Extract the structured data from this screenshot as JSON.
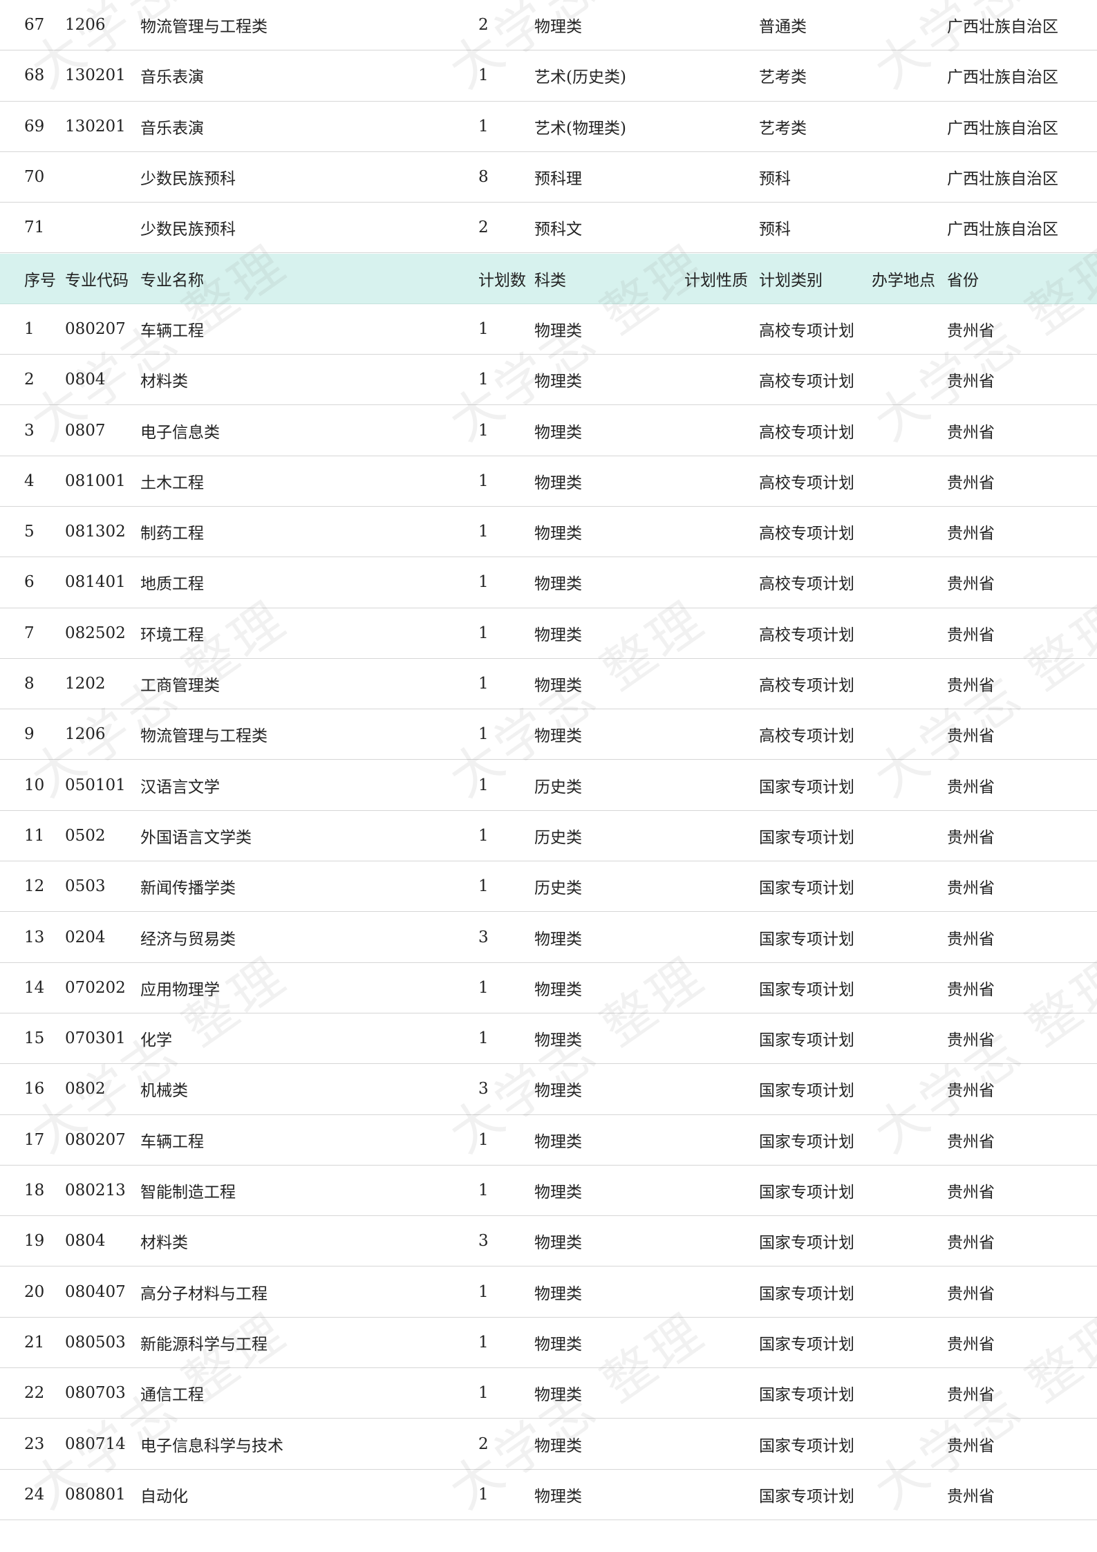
{
  "watermark": "大学志 整理",
  "prev_section_rows": [
    {
      "seq": "67",
      "code": "1206",
      "name": "物流管理与工程类",
      "num": "2",
      "subject": "物理类",
      "nature": "",
      "type": "普通类",
      "location": "",
      "province": "广西壮族自治区"
    },
    {
      "seq": "68",
      "code": "130201",
      "name": "音乐表演",
      "num": "1",
      "subject": "艺术(历史类)",
      "nature": "",
      "type": "艺考类",
      "location": "",
      "province": "广西壮族自治区"
    },
    {
      "seq": "69",
      "code": "130201",
      "name": "音乐表演",
      "num": "1",
      "subject": "艺术(物理类)",
      "nature": "",
      "type": "艺考类",
      "location": "",
      "province": "广西壮族自治区"
    },
    {
      "seq": "70",
      "code": "",
      "name": "少数民族预科",
      "num": "8",
      "subject": "预科理",
      "nature": "",
      "type": "预科",
      "location": "",
      "province": "广西壮族自治区"
    },
    {
      "seq": "71",
      "code": "",
      "name": "少数民族预科",
      "num": "2",
      "subject": "预科文",
      "nature": "",
      "type": "预科",
      "location": "",
      "province": "广西壮族自治区"
    }
  ],
  "header": {
    "seq": "序号",
    "code": "专业代码",
    "name": "专业名称",
    "num": "计划数",
    "subject": "科类",
    "nature": "计划性质",
    "type": "计划类别",
    "location": "办学地点",
    "province": "省份"
  },
  "rows": [
    {
      "seq": "1",
      "code": "080207",
      "name": "车辆工程",
      "num": "1",
      "subject": "物理类",
      "nature": "",
      "type": "高校专项计划",
      "location": "",
      "province": "贵州省"
    },
    {
      "seq": "2",
      "code": "0804",
      "name": "材料类",
      "num": "1",
      "subject": "物理类",
      "nature": "",
      "type": "高校专项计划",
      "location": "",
      "province": "贵州省"
    },
    {
      "seq": "3",
      "code": "0807",
      "name": "电子信息类",
      "num": "1",
      "subject": "物理类",
      "nature": "",
      "type": "高校专项计划",
      "location": "",
      "province": "贵州省"
    },
    {
      "seq": "4",
      "code": "081001",
      "name": "土木工程",
      "num": "1",
      "subject": "物理类",
      "nature": "",
      "type": "高校专项计划",
      "location": "",
      "province": "贵州省"
    },
    {
      "seq": "5",
      "code": "081302",
      "name": "制药工程",
      "num": "1",
      "subject": "物理类",
      "nature": "",
      "type": "高校专项计划",
      "location": "",
      "province": "贵州省"
    },
    {
      "seq": "6",
      "code": "081401",
      "name": "地质工程",
      "num": "1",
      "subject": "物理类",
      "nature": "",
      "type": "高校专项计划",
      "location": "",
      "province": "贵州省"
    },
    {
      "seq": "7",
      "code": "082502",
      "name": "环境工程",
      "num": "1",
      "subject": "物理类",
      "nature": "",
      "type": "高校专项计划",
      "location": "",
      "province": "贵州省"
    },
    {
      "seq": "8",
      "code": "1202",
      "name": "工商管理类",
      "num": "1",
      "subject": "物理类",
      "nature": "",
      "type": "高校专项计划",
      "location": "",
      "province": "贵州省"
    },
    {
      "seq": "9",
      "code": "1206",
      "name": "物流管理与工程类",
      "num": "1",
      "subject": "物理类",
      "nature": "",
      "type": "高校专项计划",
      "location": "",
      "province": "贵州省"
    },
    {
      "seq": "10",
      "code": "050101",
      "name": "汉语言文学",
      "num": "1",
      "subject": "历史类",
      "nature": "",
      "type": "国家专项计划",
      "location": "",
      "province": "贵州省"
    },
    {
      "seq": "11",
      "code": "0502",
      "name": "外国语言文学类",
      "num": "1",
      "subject": "历史类",
      "nature": "",
      "type": "国家专项计划",
      "location": "",
      "province": "贵州省"
    },
    {
      "seq": "12",
      "code": "0503",
      "name": "新闻传播学类",
      "num": "1",
      "subject": "历史类",
      "nature": "",
      "type": "国家专项计划",
      "location": "",
      "province": "贵州省"
    },
    {
      "seq": "13",
      "code": "0204",
      "name": "经济与贸易类",
      "num": "3",
      "subject": "物理类",
      "nature": "",
      "type": "国家专项计划",
      "location": "",
      "province": "贵州省"
    },
    {
      "seq": "14",
      "code": "070202",
      "name": "应用物理学",
      "num": "1",
      "subject": "物理类",
      "nature": "",
      "type": "国家专项计划",
      "location": "",
      "province": "贵州省"
    },
    {
      "seq": "15",
      "code": "070301",
      "name": "化学",
      "num": "1",
      "subject": "物理类",
      "nature": "",
      "type": "国家专项计划",
      "location": "",
      "province": "贵州省"
    },
    {
      "seq": "16",
      "code": "0802",
      "name": "机械类",
      "num": "3",
      "subject": "物理类",
      "nature": "",
      "type": "国家专项计划",
      "location": "",
      "province": "贵州省"
    },
    {
      "seq": "17",
      "code": "080207",
      "name": "车辆工程",
      "num": "1",
      "subject": "物理类",
      "nature": "",
      "type": "国家专项计划",
      "location": "",
      "province": "贵州省"
    },
    {
      "seq": "18",
      "code": "080213",
      "name": "智能制造工程",
      "num": "1",
      "subject": "物理类",
      "nature": "",
      "type": "国家专项计划",
      "location": "",
      "province": "贵州省"
    },
    {
      "seq": "19",
      "code": "0804",
      "name": "材料类",
      "num": "3",
      "subject": "物理类",
      "nature": "",
      "type": "国家专项计划",
      "location": "",
      "province": "贵州省"
    },
    {
      "seq": "20",
      "code": "080407",
      "name": "高分子材料与工程",
      "num": "1",
      "subject": "物理类",
      "nature": "",
      "type": "国家专项计划",
      "location": "",
      "province": "贵州省"
    },
    {
      "seq": "21",
      "code": "080503",
      "name": "新能源科学与工程",
      "num": "1",
      "subject": "物理类",
      "nature": "",
      "type": "国家专项计划",
      "location": "",
      "province": "贵州省"
    },
    {
      "seq": "22",
      "code": "080703",
      "name": "通信工程",
      "num": "1",
      "subject": "物理类",
      "nature": "",
      "type": "国家专项计划",
      "location": "",
      "province": "贵州省"
    },
    {
      "seq": "23",
      "code": "080714",
      "name": "电子信息科学与技术",
      "num": "2",
      "subject": "物理类",
      "nature": "",
      "type": "国家专项计划",
      "location": "",
      "province": "贵州省"
    },
    {
      "seq": "24",
      "code": "080801",
      "name": "自动化",
      "num": "1",
      "subject": "物理类",
      "nature": "",
      "type": "国家专项计划",
      "location": "",
      "province": "贵州省"
    }
  ]
}
